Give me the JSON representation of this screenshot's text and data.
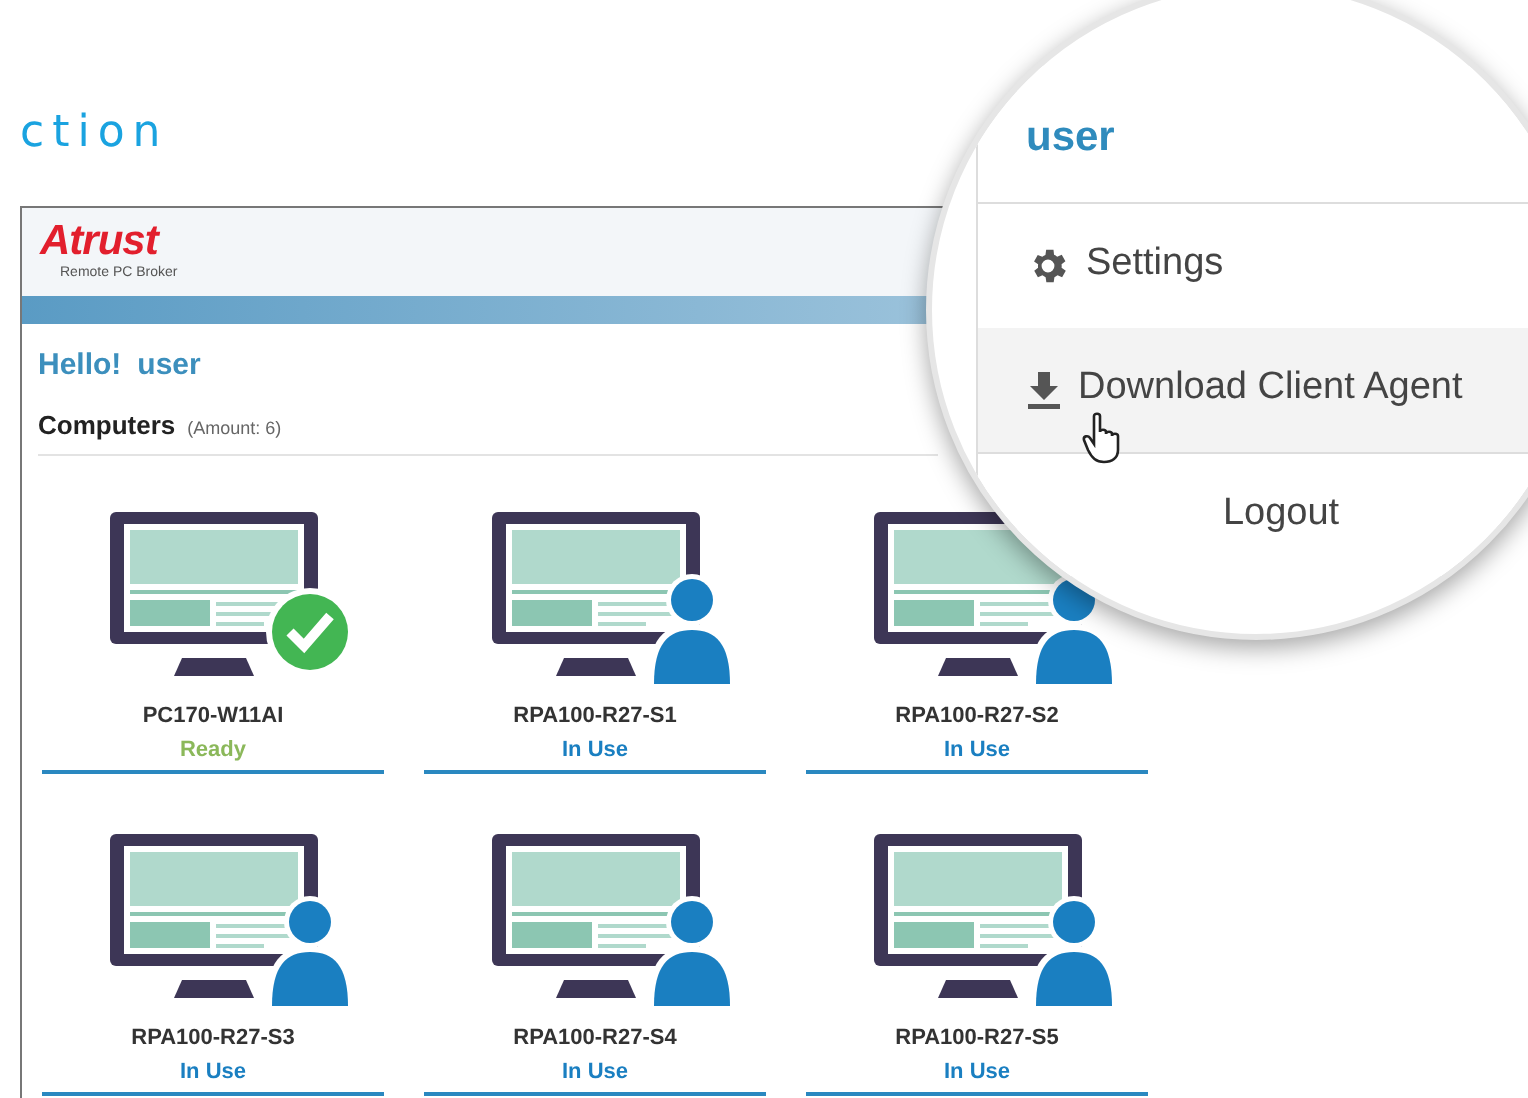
{
  "section_heading": "ction",
  "app": {
    "logo": {
      "brand": "Atrust",
      "subtitle": "Remote PC Broker"
    },
    "greeting": {
      "text": "Hello!",
      "user": "user"
    },
    "computers": {
      "title": "Computers",
      "amount": "(Amount: 6)",
      "items": [
        {
          "name": "PC170-W11AI",
          "status": "Ready",
          "kind": "ready"
        },
        {
          "name": "RPA100-R27-S1",
          "status": "In Use",
          "kind": "in_use"
        },
        {
          "name": "RPA100-R27-S2",
          "status": "In Use",
          "kind": "in_use"
        },
        {
          "name": "RPA100-R27-S3",
          "status": "In Use",
          "kind": "in_use"
        },
        {
          "name": "RPA100-R27-S4",
          "status": "In Use",
          "kind": "in_use"
        },
        {
          "name": "RPA100-R27-S5",
          "status": "In Use",
          "kind": "in_use"
        }
      ]
    }
  },
  "magnifier": {
    "user": "user",
    "menu": [
      {
        "kind": "settings",
        "label": "Settings",
        "hovered": false
      },
      {
        "kind": "download",
        "label": "Download Client Agent",
        "hovered": true
      },
      {
        "kind": "logout",
        "label": "Logout",
        "hovered": false
      }
    ]
  }
}
